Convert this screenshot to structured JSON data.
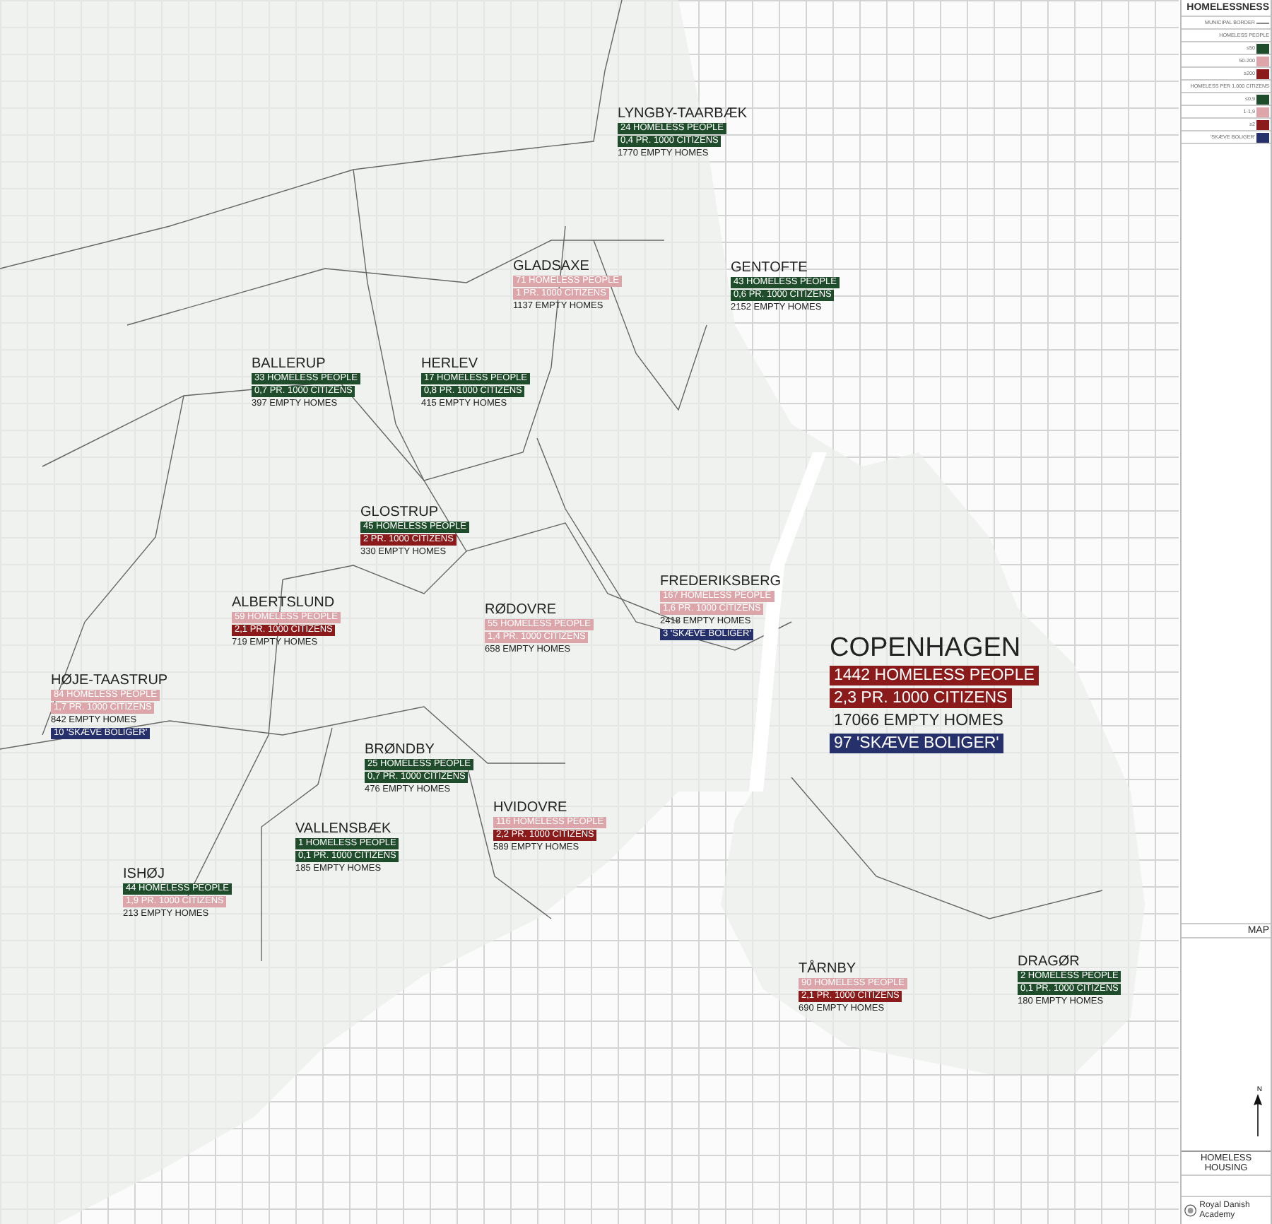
{
  "map": {
    "municipalities": [
      {
        "name": "LYNGBY-TAARBÆK",
        "major": false,
        "lines": [
          {
            "kind": "bar",
            "text": "24 HOMELESS PEOPLE",
            "color": "#1f4d2b"
          },
          {
            "kind": "bar",
            "text": "0,4 PR. 1000 CITIZENS",
            "color": "#1f4d2b"
          },
          {
            "kind": "plain",
            "text": "1770 EMPTY HOMES"
          }
        ]
      },
      {
        "name": "GLADSAXE",
        "major": false,
        "lines": [
          {
            "kind": "bar",
            "text": "71 HOMELESS PEOPLE",
            "color": "#dba5aa"
          },
          {
            "kind": "bar",
            "text": "1 PR. 1000 CITIZENS",
            "color": "#dba5aa"
          },
          {
            "kind": "plain",
            "text": "1137 EMPTY HOMES"
          }
        ]
      },
      {
        "name": "GENTOFTE",
        "major": false,
        "lines": [
          {
            "kind": "bar",
            "text": "43 HOMELESS PEOPLE",
            "color": "#1f4d2b"
          },
          {
            "kind": "bar",
            "text": "0,6 PR. 1000 CITIZENS",
            "color": "#1f4d2b"
          },
          {
            "kind": "plain",
            "text": "2152 EMPTY HOMES"
          }
        ]
      },
      {
        "name": "BALLERUP",
        "major": false,
        "lines": [
          {
            "kind": "bar",
            "text": "33 HOMELESS PEOPLE",
            "color": "#1f4d2b"
          },
          {
            "kind": "bar",
            "text": "0,7 PR. 1000 CITIZENS",
            "color": "#1f4d2b"
          },
          {
            "kind": "plain",
            "text": "397 EMPTY HOMES"
          }
        ]
      },
      {
        "name": "HERLEV",
        "major": false,
        "lines": [
          {
            "kind": "bar",
            "text": "17 HOMELESS PEOPLE",
            "color": "#1f4d2b"
          },
          {
            "kind": "bar",
            "text": "0,8 PR. 1000 CITIZENS",
            "color": "#1f4d2b"
          },
          {
            "kind": "plain",
            "text": "415 EMPTY HOMES"
          }
        ]
      },
      {
        "name": "GLOSTRUP",
        "major": false,
        "lines": [
          {
            "kind": "bar",
            "text": "45 HOMELESS PEOPLE",
            "color": "#1f4d2b"
          },
          {
            "kind": "bar",
            "text": "2 PR. 1000 CITIZENS",
            "color": "#8b1a1a"
          },
          {
            "kind": "plain",
            "text": "330 EMPTY HOMES"
          }
        ]
      },
      {
        "name": "ALBERTSLUND",
        "major": false,
        "lines": [
          {
            "kind": "bar",
            "text": "59 HOMELESS PEOPLE",
            "color": "#dba5aa"
          },
          {
            "kind": "bar",
            "text": "2,1 PR. 1000 CITIZENS",
            "color": "#8b1a1a"
          },
          {
            "kind": "plain",
            "text": "719 EMPTY HOMES"
          }
        ]
      },
      {
        "name": "RØDOVRE",
        "major": false,
        "lines": [
          {
            "kind": "bar",
            "text": "55 HOMELESS PEOPLE",
            "color": "#dba5aa"
          },
          {
            "kind": "bar",
            "text": "1,4 PR. 1000 CITIZENS",
            "color": "#dba5aa"
          },
          {
            "kind": "plain",
            "text": "658 EMPTY HOMES"
          }
        ]
      },
      {
        "name": "FREDERIKSBERG",
        "major": false,
        "lines": [
          {
            "kind": "bar",
            "text": "167 HOMELESS PEOPLE",
            "color": "#dba5aa"
          },
          {
            "kind": "bar",
            "text": "1,6 PR. 1000 CITIZENS",
            "color": "#dba5aa"
          },
          {
            "kind": "plain",
            "text": "2418 EMPTY HOMES"
          },
          {
            "kind": "bar",
            "text": "3 'SKÆVE BOLIGER'",
            "color": "#26316b"
          }
        ]
      },
      {
        "name": "HØJE-TAASTRUP",
        "major": false,
        "lines": [
          {
            "kind": "bar",
            "text": "84 HOMELESS PEOPLE",
            "color": "#dba5aa"
          },
          {
            "kind": "bar",
            "text": "1,7 PR. 1000 CITIZENS",
            "color": "#dba5aa"
          },
          {
            "kind": "plain",
            "text": "842 EMPTY HOMES"
          },
          {
            "kind": "bar",
            "text": "10 'SKÆVE BOLIGER'",
            "color": "#26316b"
          }
        ]
      },
      {
        "name": "COPENHAGEN",
        "major": true,
        "lines": [
          {
            "kind": "bar",
            "text": "1442 HOMELESS PEOPLE",
            "color": "#8b1a1a"
          },
          {
            "kind": "bar",
            "text": "2,3 PR. 1000 CITIZENS",
            "color": "#8b1a1a"
          },
          {
            "kind": "plain",
            "text": "17066 EMPTY HOMES"
          },
          {
            "kind": "bar",
            "text": "97 'SKÆVE BOLIGER'",
            "color": "#26316b"
          }
        ]
      },
      {
        "name": "BRØNDBY",
        "major": false,
        "lines": [
          {
            "kind": "bar",
            "text": "25 HOMELESS PEOPLE",
            "color": "#1f4d2b"
          },
          {
            "kind": "bar",
            "text": "0,7 PR. 1000 CITIZENS",
            "color": "#1f4d2b"
          },
          {
            "kind": "plain",
            "text": "476 EMPTY HOMES"
          }
        ]
      },
      {
        "name": "HVIDOVRE",
        "major": false,
        "lines": [
          {
            "kind": "bar",
            "text": "116 HOMELESS PEOPLE",
            "color": "#dba5aa"
          },
          {
            "kind": "bar",
            "text": "2,2 PR. 1000 CITIZENS",
            "color": "#8b1a1a"
          },
          {
            "kind": "plain",
            "text": "589 EMPTY HOMES"
          }
        ]
      },
      {
        "name": "VALLENSBÆK",
        "major": false,
        "lines": [
          {
            "kind": "bar",
            "text": "1 HOMELESS PEOPLE",
            "color": "#1f4d2b"
          },
          {
            "kind": "bar",
            "text": "0,1 PR. 1000 CITIZENS",
            "color": "#1f4d2b"
          },
          {
            "kind": "plain",
            "text": "185 EMPTY HOMES"
          }
        ]
      },
      {
        "name": "ISHØJ",
        "major": false,
        "lines": [
          {
            "kind": "bar",
            "text": "44 HOMELESS PEOPLE",
            "color": "#1f4d2b"
          },
          {
            "kind": "bar",
            "text": "1,9 PR. 1000 CITIZENS",
            "color": "#dba5aa"
          },
          {
            "kind": "plain",
            "text": "213 EMPTY HOMES"
          }
        ]
      },
      {
        "name": "TÅRNBY",
        "major": false,
        "lines": [
          {
            "kind": "bar",
            "text": "90 HOMELESS PEOPLE",
            "color": "#dba5aa"
          },
          {
            "kind": "bar",
            "text": "2,1 PR. 1000 CITIZENS",
            "color": "#8b1a1a"
          },
          {
            "kind": "plain",
            "text": "690 EMPTY HOMES"
          }
        ]
      },
      {
        "name": "DRAGØR",
        "major": false,
        "lines": [
          {
            "kind": "bar",
            "text": "2 HOMELESS PEOPLE",
            "color": "#1f4d2b"
          },
          {
            "kind": "bar",
            "text": "0,1 PR. 1000 CITIZENS",
            "color": "#1f4d2b"
          },
          {
            "kind": "plain",
            "text": "180 EMPTY HOMES"
          }
        ]
      }
    ]
  },
  "legend": {
    "title": "HOMELESSNESS",
    "rows": [
      {
        "kind": "line",
        "text": "MUNICIPAL BORDER"
      },
      {
        "kind": "heading",
        "text": "HOMELESS PEOPLE"
      },
      {
        "kind": "swatch",
        "text": "≤50",
        "color": "#1f4d2b"
      },
      {
        "kind": "swatch",
        "text": "50-200",
        "color": "#dba5aa"
      },
      {
        "kind": "swatch",
        "text": "≥200",
        "color": "#8b1a1a"
      },
      {
        "kind": "heading",
        "text": "HOMELESS PER 1.000 CITIZENS"
      },
      {
        "kind": "swatch",
        "text": "≤0,9",
        "color": "#1f4d2b"
      },
      {
        "kind": "swatch",
        "text": "1-1,9",
        "color": "#dba5aa"
      },
      {
        "kind": "swatch",
        "text": "≥2",
        "color": "#8b1a1a"
      },
      {
        "kind": "swatch",
        "text": "'SKÆVE BOLIGER'",
        "color": "#26316b"
      }
    ]
  },
  "title_block": {
    "sheet": "MAP",
    "north": "N",
    "project": "HOMELESS HOUSING",
    "school": "Royal Danish Academy"
  }
}
